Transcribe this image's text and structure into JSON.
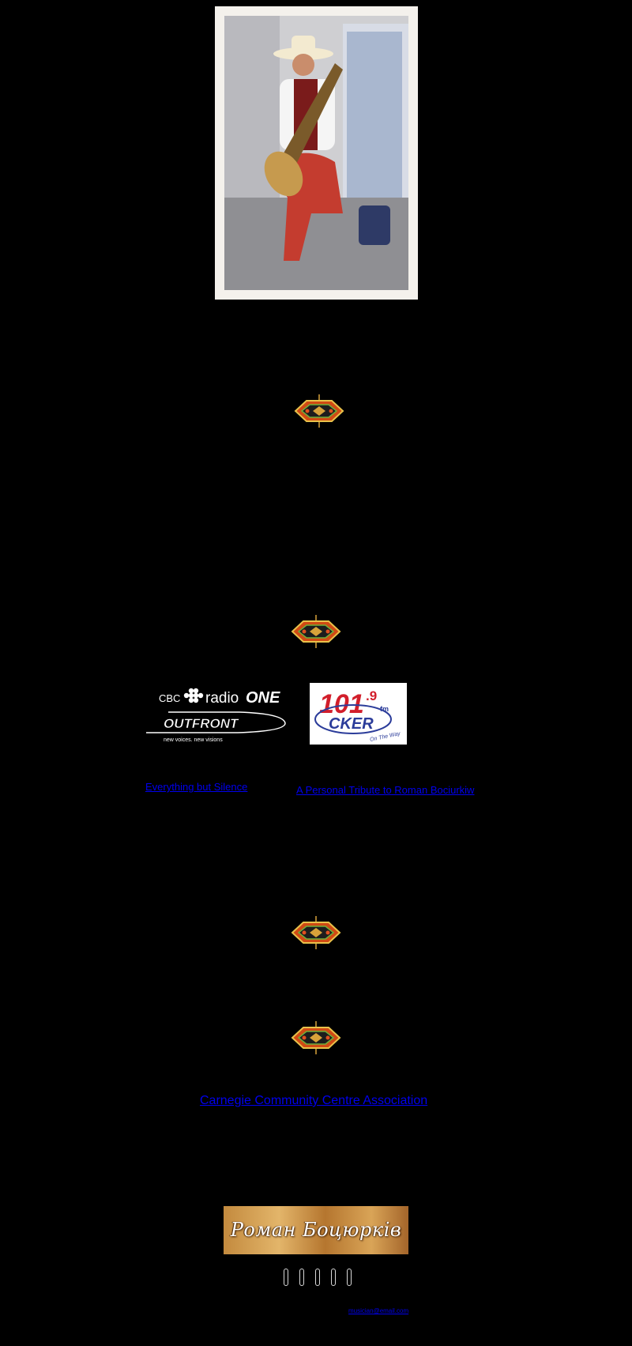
{
  "hero": {
    "icon": "musician-photo"
  },
  "ornaments": [
    "ornament-icon",
    "ornament-icon",
    "ornament-icon",
    "ornament-icon"
  ],
  "logos": {
    "cbc": {
      "line1_prefix": "CBC",
      "line1_suffix": "radio",
      "line1_bold": "ONE",
      "line2": "OUTFRONT",
      "tagline": "new voices. new visions"
    },
    "cker": {
      "freq_main": "101",
      "freq_decimal": ".9",
      "freq_unit": "fm",
      "station": "CKER",
      "slogan": "On The Way"
    }
  },
  "links": {
    "everything_but_silence": "Everything but Silence",
    "tribute": "A Personal Tribute to Roman Bociurkiw",
    "carnegie": "Carnegie Community Centre Association"
  },
  "banner": {
    "name": "Роман Боцюрків"
  },
  "nav": {
    "buttons": [
      "",
      "",
      "",
      "",
      ""
    ]
  },
  "footer": {
    "email": "musician@email.com"
  },
  "colors": {
    "background": "#000000",
    "link": "#0000ee"
  }
}
